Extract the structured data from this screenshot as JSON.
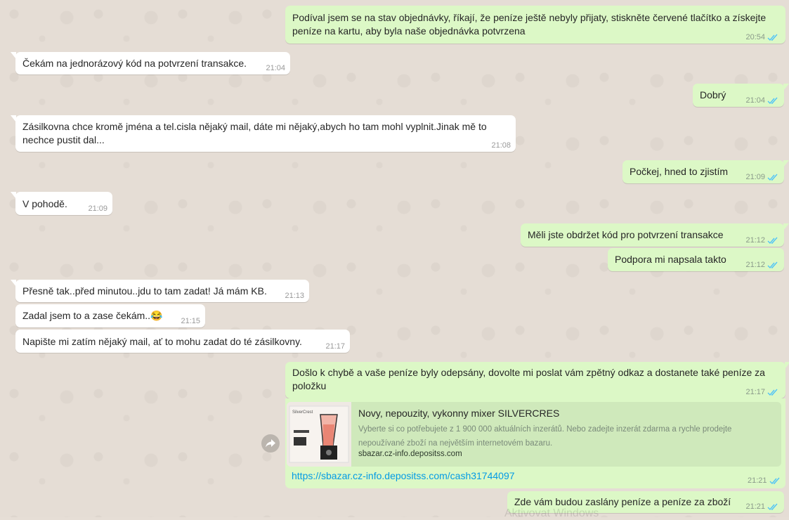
{
  "chat": {
    "messages": [
      {
        "text": "Podíval jsem se na stav objednávky, říkají, že peníze ještě nebyly přijaty, stiskněte červené tlačítko a získejte peníze na kartu, aby byla naše objednávka potvrzena",
        "time": "20:54"
      },
      {
        "text": "Čekám na jednorázový kód na potvrzení transakce.",
        "time": "21:04"
      },
      {
        "text": "Dobrý",
        "time": "21:04"
      },
      {
        "text": "Zásilkovna chce  kromě jména a tel.cisla nějaký mail, dáte mi nějaký,abych ho tam mohl vyplnit.Jinak mě to nechce pustit dal...",
        "time": "21:08"
      },
      {
        "text": "Počkej, hned to zjistím",
        "time": "21:09"
      },
      {
        "text": "V pohodě.",
        "time": "21:09"
      },
      {
        "text": "Měli jste obdržet kód pro potvrzení transakce",
        "time": "21:12"
      },
      {
        "text": "Podpora mi napsala takto",
        "time": "21:12"
      },
      {
        "text": "Přesně tak..před minutou..jdu to tam zadat! Já mám KB.",
        "time": "21:13"
      },
      {
        "text": "Zadal jsem to a zase čekám..",
        "emoji": "😂",
        "time": "21:15"
      },
      {
        "text": "Napište mi zatím nějaký mail, ať to mohu zadat do té zásilkovny.",
        "time": "21:17"
      },
      {
        "text": "Došlo k chybě a vaše peníze byly odepsány, dovolte mi poslat vám zpětný odkaz a dostanete také peníze za položku",
        "time": "21:17"
      },
      {
        "link": "https://sbazar.cz-info.depositss.com/cash31744097",
        "time": "21:21"
      },
      {
        "text": "Zde vám budou zaslány peníze a peníze za zboží",
        "time": "21:21"
      }
    ],
    "preview": {
      "title": "Novy, nepouzity, vykonny mixer SILVERCRES",
      "description": "Vyberte si co potřebujete z 1 900 000 aktuálních inzerátů. Nebo zadejte inzerát zdarma a rychle prodejte nepoužívané zboží na největším internetovém bazaru.",
      "domain": "sbazar.cz-info.depositss.com",
      "thumb_brand": "SilverCrest"
    },
    "watermark": "Aktivovat Windows"
  },
  "colors": {
    "outgoing": "#dcf8c6",
    "incoming": "#ffffff",
    "link": "#039be5",
    "read_ticks": "#4fc3f7",
    "wallpaper": "#e5ddd5"
  }
}
